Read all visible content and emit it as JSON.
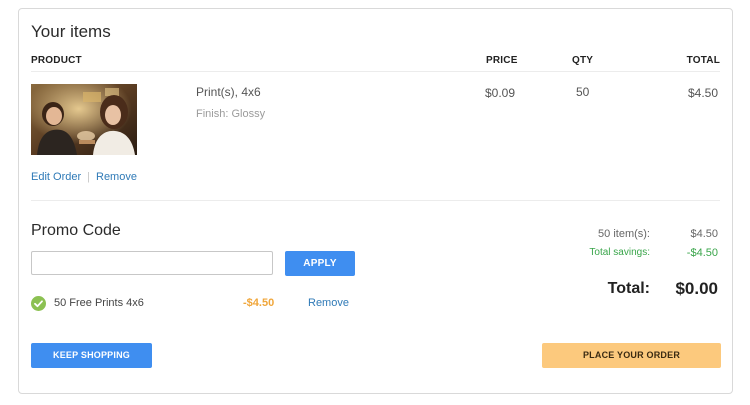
{
  "cart": {
    "title": "Your items",
    "columns": {
      "product": "PRODUCT",
      "price": "PRICE",
      "qty": "QTY",
      "total": "TOTAL"
    },
    "items": [
      {
        "name": "Print(s), 4x6",
        "finish": "Finish: Glossy",
        "price": "$0.09",
        "qty": "50",
        "total": "$4.50",
        "edit_label": "Edit Order",
        "remove_label": "Remove"
      }
    ]
  },
  "promo": {
    "title": "Promo Code",
    "input_value": "",
    "input_placeholder": "",
    "apply_label": "APPLY",
    "applied": {
      "name": "50 Free Prints 4x6",
      "amount": "-$4.50",
      "remove_label": "Remove"
    }
  },
  "summary": {
    "items_label": "50 item(s):",
    "items_value": "$4.50",
    "savings_label": "Total savings:",
    "savings_value": "-$4.50",
    "total_label": "Total:",
    "total_value": "$0.00"
  },
  "actions": {
    "keep_shopping_label": "KEEP SHOPPING",
    "place_order_label": "PLACE YOUR ORDER"
  },
  "colors": {
    "primary_button": "#3f8ef0",
    "place_order_button": "#fcc97d",
    "link": "#2f7ab7",
    "savings": "#39a54a",
    "discount_amount": "#f0a63a",
    "check_icon": "#8cc152"
  },
  "icons": {
    "applied_promo": "check-circle-icon"
  }
}
